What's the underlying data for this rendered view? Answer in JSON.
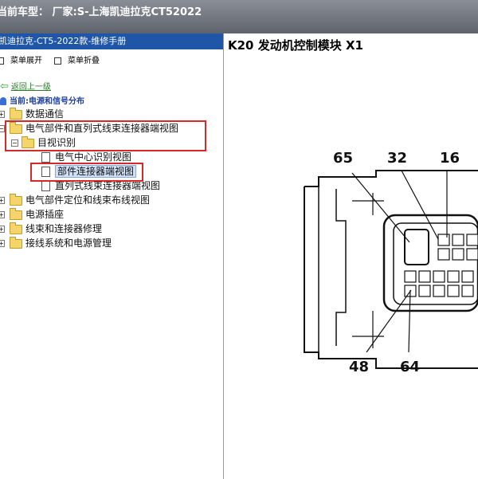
{
  "header": {
    "title": "当前车型：  厂家:S-上海凯迪拉克CT52022"
  },
  "sidebar": {
    "manual_title": "凯迪拉克-CT5-2022款-维修手册",
    "expand_label": "菜单展开",
    "collapse_label": "菜单折叠",
    "back_label": "返回上一级",
    "current_label": "当前:电源和信号分布",
    "tree": [
      {
        "label": "数据通信"
      },
      {
        "label": "电气部件和直列式线束连接器端视图"
      },
      {
        "label": "目视识别"
      },
      {
        "label": "电气中心识别视图"
      },
      {
        "label": "部件连接器端视图"
      },
      {
        "label": "直列式线束连接器端视图"
      },
      {
        "label": "电气部件定位和线束布线视图"
      },
      {
        "label": "电源插座"
      },
      {
        "label": "线束和连接器修理"
      },
      {
        "label": "接线系统和电源管理"
      }
    ]
  },
  "document": {
    "title": "K20 发动机控制模块 X1",
    "pin_labels": [
      "65",
      "32",
      "16",
      "48",
      "64"
    ]
  }
}
